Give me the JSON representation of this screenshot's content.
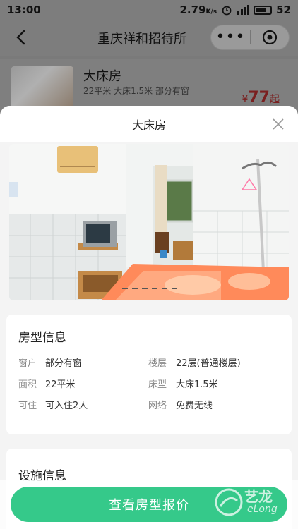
{
  "status": {
    "time": "13:00",
    "speed": "2.79",
    "speed_unit": "K/s",
    "battery": "52"
  },
  "nav": {
    "title": "重庆祥和招待所"
  },
  "background_room": {
    "name": "大床房",
    "specs": "22平米  大床1.5米  部分有窗",
    "price_symbol": "¥",
    "price": "77",
    "price_suffix": "起"
  },
  "sheet": {
    "title": "大床房",
    "info_title": "房型信息",
    "info_rows": [
      {
        "label_a": "窗户",
        "value_a": "部分有窗",
        "label_b": "楼层",
        "value_b": "22层(普通楼层)"
      },
      {
        "label_a": "面积",
        "value_a": "22平米",
        "label_b": "床型",
        "value_b": "大床1.5米"
      },
      {
        "label_a": "可住",
        "value_a": "可入住2人",
        "label_b": "网络",
        "value_b": "免费无线"
      }
    ],
    "facility_title": "设施信息",
    "cta_label": "查看房型报价"
  },
  "watermark": {
    "cn": "艺龙",
    "en": "eLong"
  },
  "colors": {
    "accent": "#35c98a",
    "price": "#e03030",
    "overlay": "#7a7a7a"
  }
}
